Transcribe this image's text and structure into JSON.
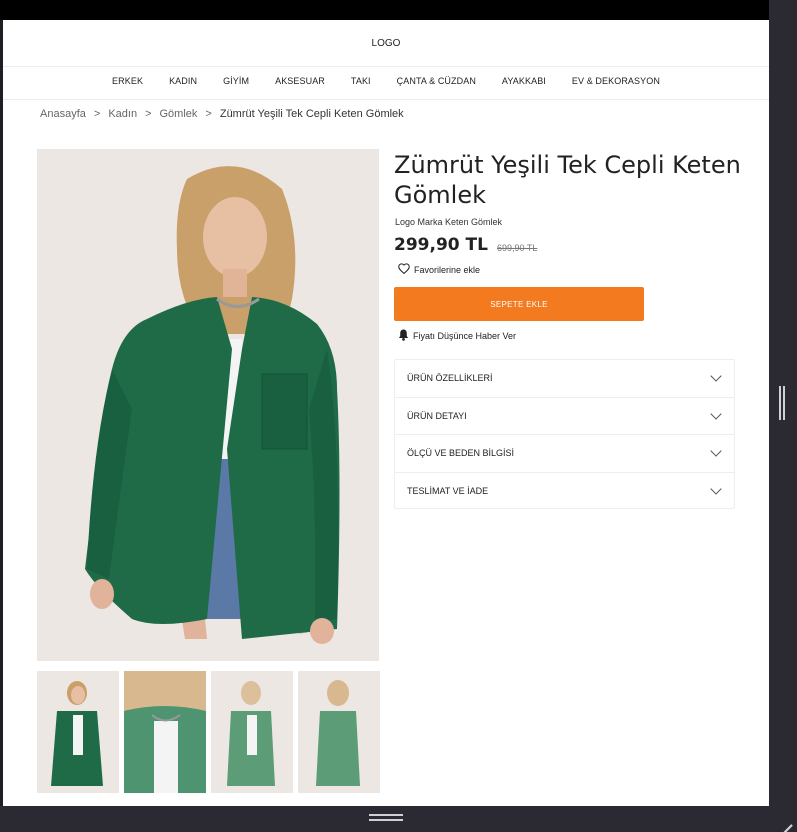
{
  "header": {
    "logo": "LOGO"
  },
  "nav": [
    "ERKEK",
    "KADIN",
    "GİYİM",
    "AKSESUAR",
    "TAKI",
    "ÇANTA & CÜZDAN",
    "AYAKKABI",
    "EV & DEKORASYON"
  ],
  "breadcrumb": {
    "items": [
      "Anasayfa",
      "Kadın",
      "Gömlek"
    ],
    "current": "Zümrüt Yeşili Tek Cepli Keten Gömlek",
    "separator": ">"
  },
  "product": {
    "title": "Zümrüt Yeşili Tek Cepli Keten Gömlek",
    "brand_line": "Logo Marka Keten Gömlek",
    "price": "299,90 TL",
    "old_price": "699,90 TL",
    "favorite_label": "Favorilerine ekle",
    "cart_button": "SEPETE EKLE",
    "price_alert": "Fiyatı Düşünce Haber Ver",
    "accordion": [
      "ÜRÜN ÖZELLİKLERİ",
      "ÜRÜN DETAYI",
      "ÖLÇÜ VE BEDEN BİLGİSİ",
      "TESLİMAT VE İADE"
    ]
  },
  "colors": {
    "accent": "#f47a20",
    "shirt": "#1f6b47",
    "text": "#222222"
  }
}
